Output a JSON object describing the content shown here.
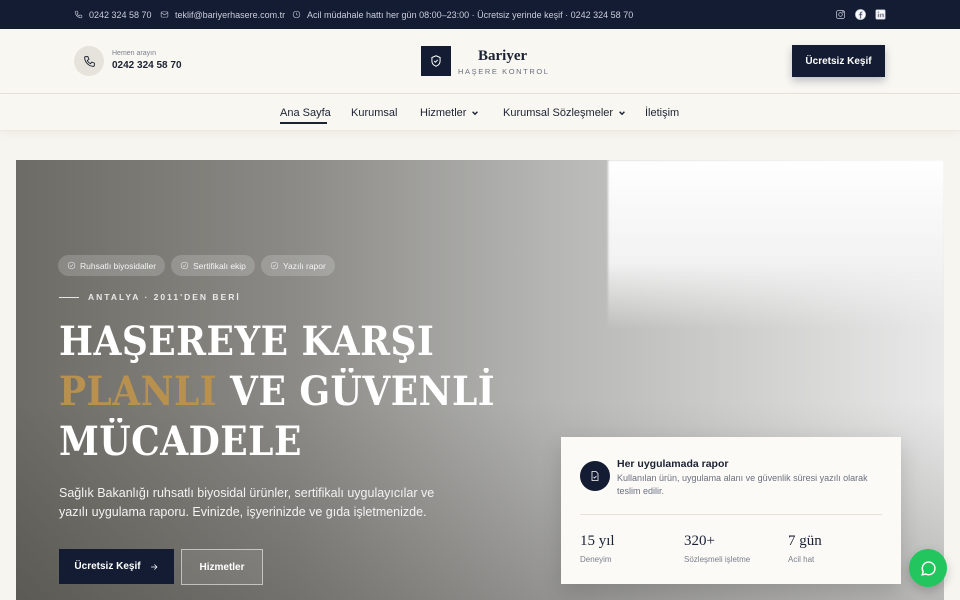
{
  "topbar": {
    "phone": "0242 324 58 70",
    "email": "teklif@bariyerhasere.com.tr",
    "hours": "Acil müdahale hattı her gün 08:00–23:00 · Ücretsiz yerinde keşif · 0242 324 58 70",
    "social": [
      "instagram-icon",
      "facebook-icon",
      "linkedin-icon"
    ]
  },
  "header": {
    "call_label": "Hemen arayın",
    "call_phone": "0242 324 58 70",
    "logo_name": "Bariyer",
    "logo_sub": "HAŞERE KONTROL",
    "cta": "Ücretsiz Keşif"
  },
  "nav": {
    "items": [
      {
        "label": "Ana Sayfa",
        "active": true
      },
      {
        "label": "Kurumsal"
      },
      {
        "label": "Hizmetler",
        "dropdown": true
      },
      {
        "label": "Kurumsal Sözleşmeler",
        "dropdown": true
      },
      {
        "label": "İletişim"
      }
    ]
  },
  "hero": {
    "badges": [
      "Ruhsatlı biyosidaller",
      "Sertifikalı ekip",
      "Yazılı rapor"
    ],
    "eyebrow": "ANTALYA · 2011'DEN BERİ",
    "title_line1": "HAŞEREYE KARŞI",
    "title_line2_gold": "PLANLI",
    "title_line2_rest": " VE GÜVENLİ",
    "title_line3": "MÜCADELE",
    "description": "Sağlık Bakanlığı ruhsatlı biyosidal ürünler, sertifikalı uygulayıcılar ve yazılı uygulama raporu. Evinizde, işyerinizde ve gıda işletmenizde.",
    "primary_button": "Ücretsiz Keşif",
    "secondary_button": "Hizmetler"
  },
  "info_card": {
    "title": "Her uygulamada rapor",
    "description": "Kullanılan ürün, uygulama alanı ve güvenlik süresi yazılı olarak teslim edilir.",
    "stats": [
      {
        "value": "15 yıl",
        "label": "Deneyim"
      },
      {
        "value": "320+",
        "label": "Sözleşmeli işletme"
      },
      {
        "value": "7 gün",
        "label": "Acil hat"
      }
    ]
  },
  "colors": {
    "navy": "#141c33",
    "gold": "#b8914f",
    "whatsapp": "#22c55e",
    "background": "#f7f5f0"
  }
}
